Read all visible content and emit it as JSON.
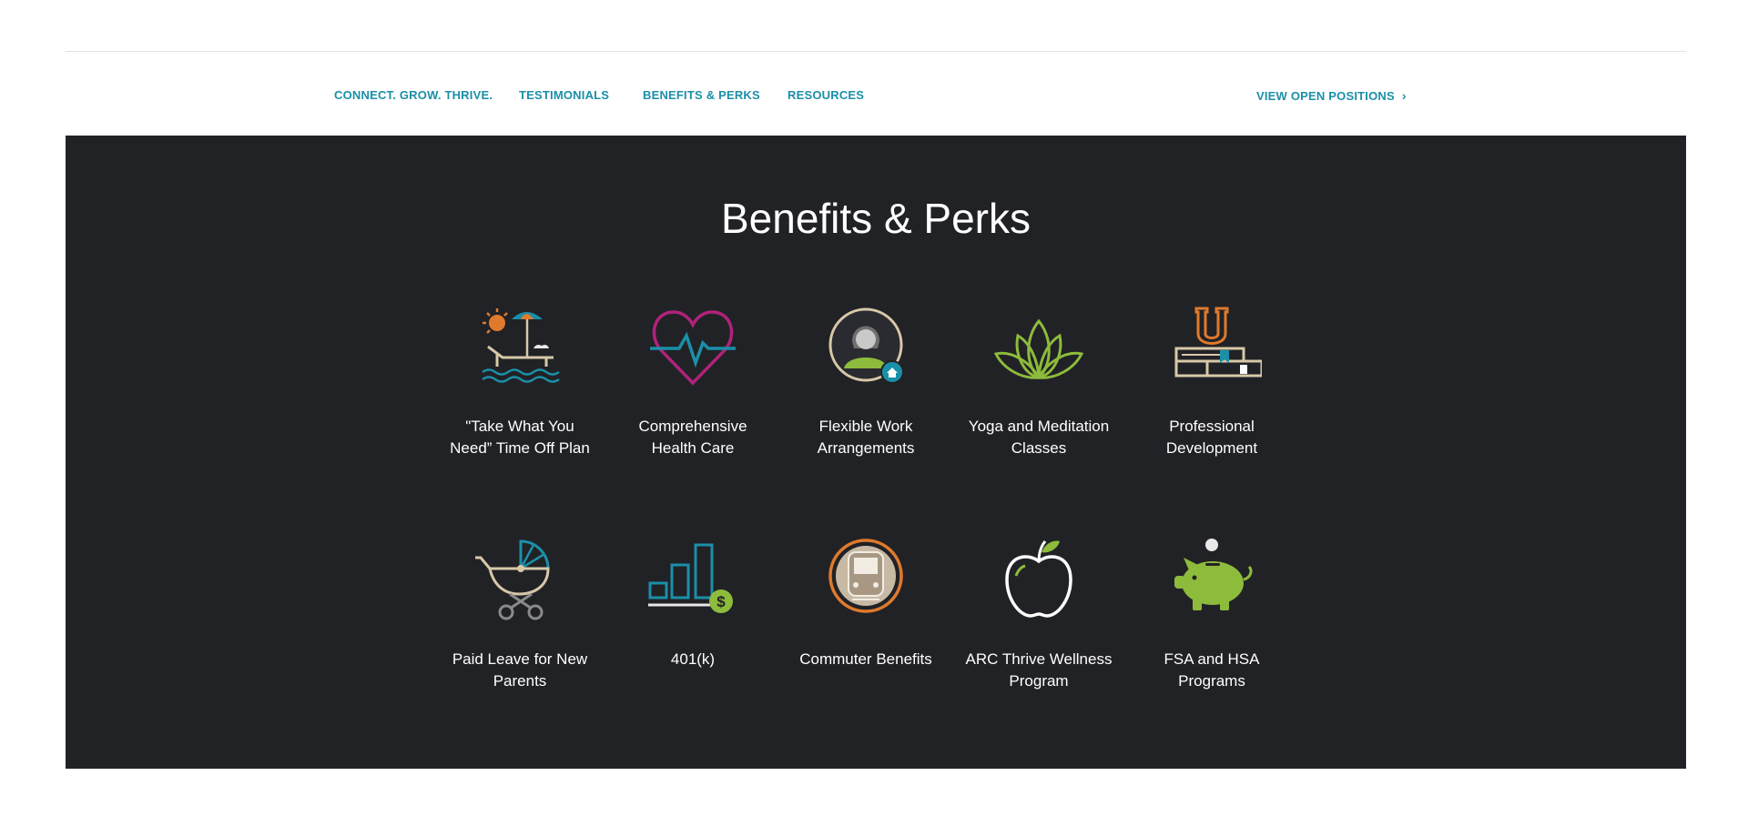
{
  "subnav": {
    "items": [
      {
        "label": "CONNECT. GROW. THRIVE."
      },
      {
        "label": "TESTIMONIALS"
      },
      {
        "label": "BENEFITS & PERKS"
      },
      {
        "label": "RESOURCES"
      }
    ],
    "cta": {
      "label": "VIEW OPEN POSITIONS",
      "icon": "chevron-right-icon"
    }
  },
  "benefits": {
    "title": "Benefits & Perks",
    "perks": [
      {
        "label": "\"Take What You Need” Time Off Plan",
        "icon": "beach-lounger-icon"
      },
      {
        "label": "Comprehensive Health Care",
        "icon": "heartbeat-icon"
      },
      {
        "label": "Flexible Work Arrangements",
        "icon": "remote-worker-icon"
      },
      {
        "label": "Yoga and Meditation Classes",
        "icon": "lotus-icon"
      },
      {
        "label": "Professional Development",
        "icon": "university-books-icon"
      },
      {
        "label": "Paid Leave for New Parents",
        "icon": "baby-stroller-icon"
      },
      {
        "label": "401(k)",
        "icon": "savings-chart-icon"
      },
      {
        "label": "Commuter Benefits",
        "icon": "train-icon"
      },
      {
        "label": "ARC Thrive Wellness Program",
        "icon": "apple-icon"
      },
      {
        "label": "FSA and HSA Programs",
        "icon": "piggy-bank-icon"
      }
    ]
  },
  "colors": {
    "accent": "#1b8fa8",
    "panel_bg": "#212226",
    "green": "#8dbb3c",
    "orange": "#e07a2c",
    "magenta": "#b0227a",
    "tan": "#d8c8a8"
  }
}
